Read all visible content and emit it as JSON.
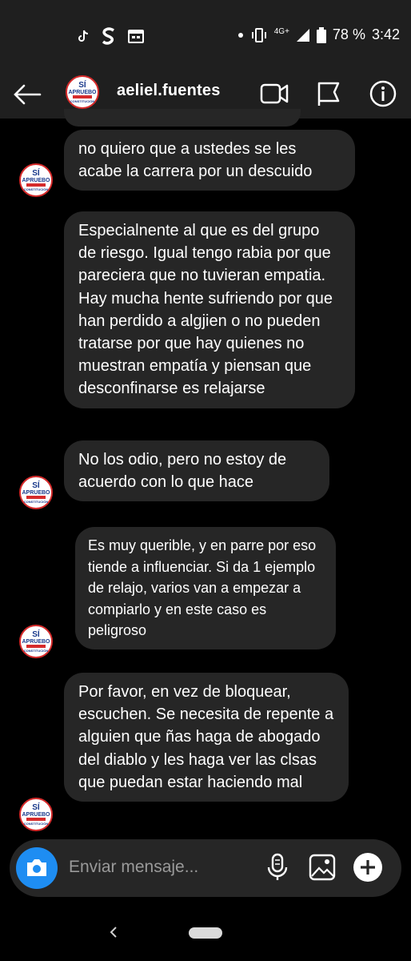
{
  "status_bar": {
    "icons": [
      "tiktok-icon",
      "s-app-icon",
      "calendar-icon"
    ],
    "right_icons": [
      "dot-icon",
      "vibrate-icon",
      "signal-icon",
      "battery-icon"
    ],
    "network": "4G+",
    "battery": "78 %",
    "time": "3:42"
  },
  "header": {
    "username": "aeliel.fuentes",
    "actions": [
      "video-call-icon",
      "flag-icon",
      "info-icon"
    ]
  },
  "messages": [
    {
      "text": "no quiero que a ustedes se les acabe la carrera por un descuido"
    },
    {
      "text": "Especialnente al que es del grupo de riesgo. Igual tengo rabia por que pareciera que no tuvieran empatia. Hay mucha hente sufriendo por que han perdido a algjien o no pueden tratarse por que hay quienes no muestran empatía y piensan que desconfinarse es relajarse"
    },
    {
      "text": "No los odio, pero no estoy de acuerdo con lo que hace"
    },
    {
      "text": "Es muy querible, y en parre por eso tiende a influenciar. Si da 1 ejemplo de relajo, varios van a empezar a compiarlo y en este caso es peligroso"
    },
    {
      "text": "Por favor, en vez de bloquear, escuchen. Se necesita de repente a alguien que ñas haga de abogado del diablo y les haga ver las clsas que puedan estar haciendo mal"
    }
  ],
  "avatar_logo": {
    "line1": "SÍ",
    "line2": "APRUEBO",
    "line3": "NUEVA",
    "line4": "CONSTITUCIÓN"
  },
  "composer": {
    "placeholder": "Enviar mensaje...",
    "icons": [
      "camera-icon",
      "microphone-icon",
      "gallery-icon",
      "add-icon"
    ]
  },
  "colors": {
    "bg": "#000000",
    "bar": "#1f1f1f",
    "bubble": "#262626",
    "camera_accent": "#1e8df2"
  }
}
